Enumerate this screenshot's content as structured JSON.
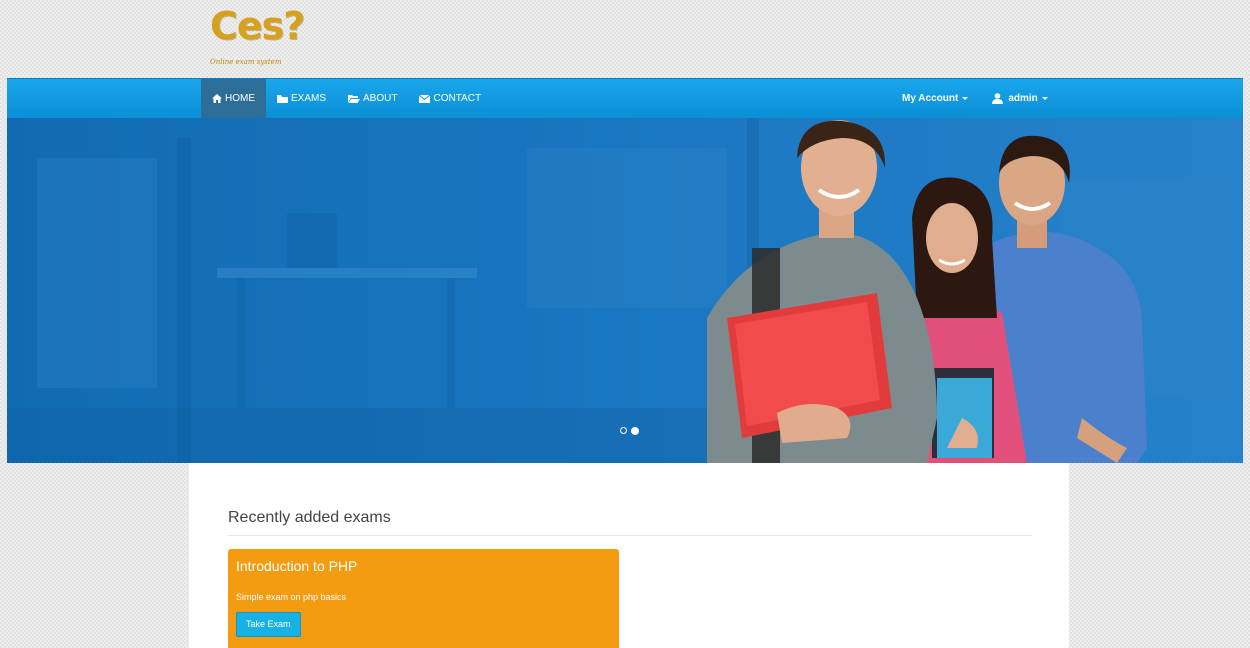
{
  "brand": {
    "logo_text": "Ces?",
    "tagline": "Online exam system"
  },
  "nav": {
    "home": "HOME",
    "exams": "EXAMS",
    "about": "ABOUT",
    "contact": "CONTACT",
    "my_account": "My Account",
    "user": "admin"
  },
  "carousel": {
    "slides": 2,
    "active_slide": 2
  },
  "content": {
    "section_title": "Recently added exams",
    "exams": [
      {
        "title": "Introduction to PHP",
        "description": "Simple exam on php basics",
        "button": "Take Exam"
      }
    ]
  },
  "colors": {
    "navbar": "#0b8fd6",
    "nav_active": "#2c6e97",
    "hero_bg": "#1976c0",
    "exam_card": "#f39c12",
    "button": "#18b1e6",
    "logo": "#d6a21e"
  }
}
